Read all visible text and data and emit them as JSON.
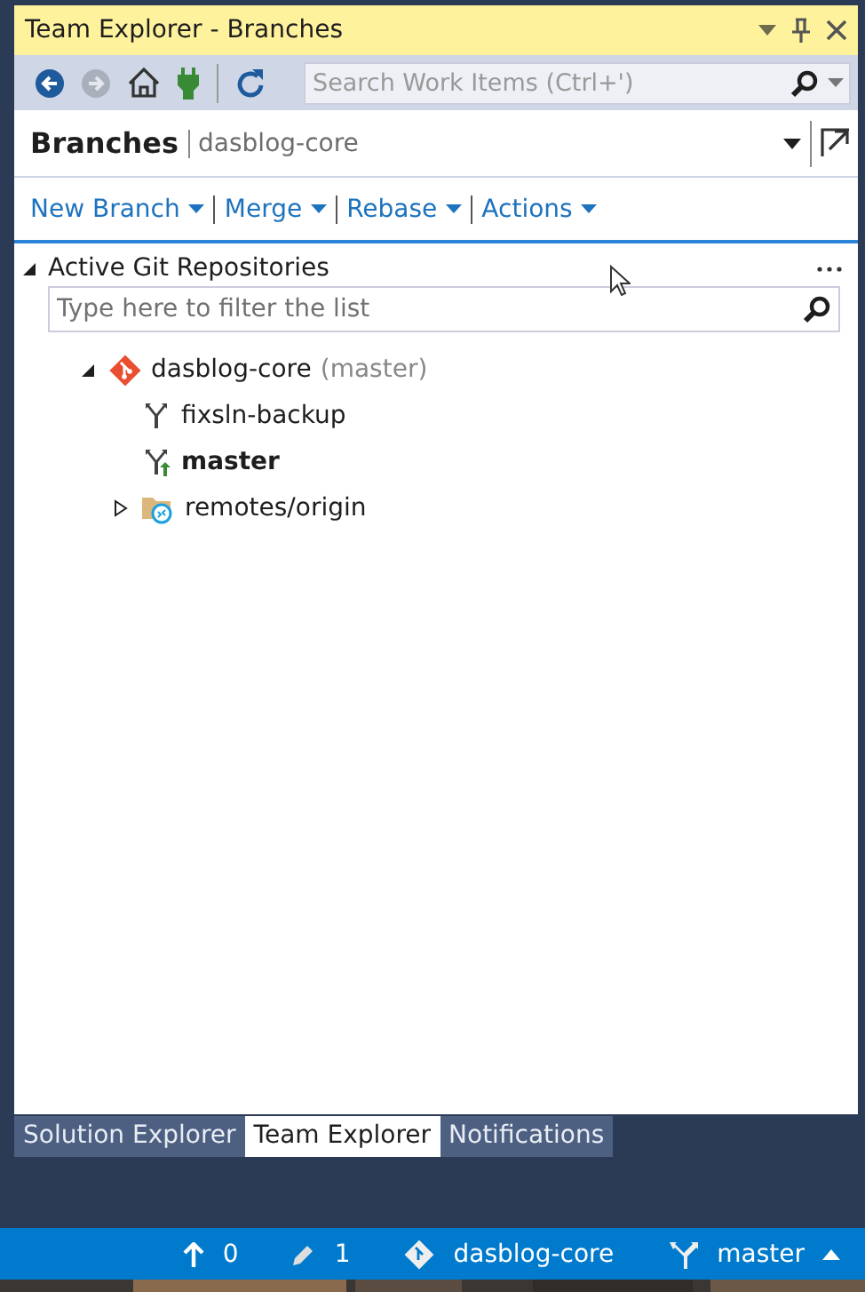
{
  "window": {
    "title": "Team Explorer - Branches"
  },
  "toolbar": {
    "search": {
      "placeholder": "Search Work Items (Ctrl+')"
    }
  },
  "header": {
    "title": "Branches",
    "context": "dasblog-core"
  },
  "actions": [
    {
      "label": "New Branch"
    },
    {
      "label": "Merge"
    },
    {
      "label": "Rebase"
    },
    {
      "label": "Actions"
    }
  ],
  "section": {
    "title": "Active Git Repositories",
    "expanded": true,
    "filter": {
      "placeholder": "Type here to filter the list"
    }
  },
  "repositories": [
    {
      "name": "dasblog-core",
      "hint": "(master)",
      "expanded": true,
      "children": [
        {
          "kind": "branch",
          "name": "fixsln-backup",
          "current": false
        },
        {
          "kind": "branch",
          "name": "master",
          "current": true
        },
        {
          "kind": "folder",
          "name": "remotes/origin",
          "expanded": false
        }
      ]
    }
  ],
  "tabs": [
    {
      "label": "Solution Explorer",
      "selected": false
    },
    {
      "label": "Team Explorer",
      "selected": true
    },
    {
      "label": "Notifications",
      "selected": false
    }
  ],
  "status_bar": {
    "push": "0",
    "changes": "1",
    "repository": "dasblog-core",
    "branch": "master"
  }
}
